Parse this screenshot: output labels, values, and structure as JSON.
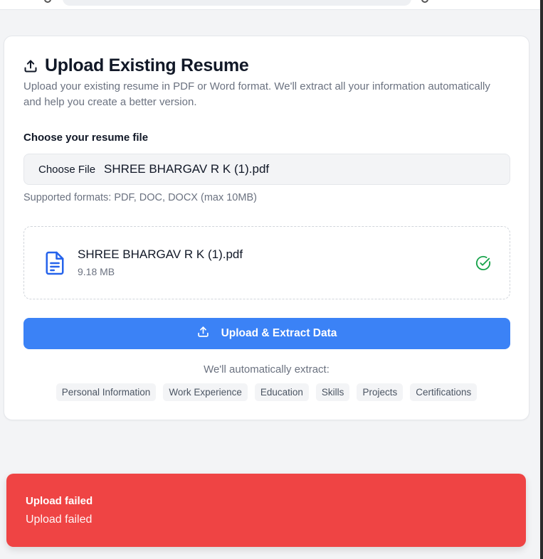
{
  "card": {
    "title": "Upload Existing Resume",
    "description": "Upload your existing resume in PDF or Word format. We'll extract all your information automatically and help you create a better version.",
    "file_label": "Choose your resume file",
    "choose_button": "Choose File",
    "chosen_file": "SHREE BHARGAV R K (1).pdf",
    "supported_formats": "Supported formats: PDF, DOC, DOCX (max 10MB)",
    "selected_file": {
      "name": "SHREE BHARGAV R K (1).pdf",
      "size": "9.18 MB",
      "icon": "file-text-icon",
      "status_icon": "check-circle-icon"
    },
    "upload_button": "Upload & Extract Data",
    "extract_label": "We'll automatically extract:",
    "chips": [
      "Personal Information",
      "Work Experience",
      "Education",
      "Skills",
      "Projects",
      "Certifications"
    ]
  },
  "toast": {
    "title": "Upload failed",
    "message": "Upload failed"
  },
  "colors": {
    "primary": "#3b82f6",
    "error": "#ef4444",
    "success": "#16a34a",
    "file_icon": "#2563eb"
  }
}
